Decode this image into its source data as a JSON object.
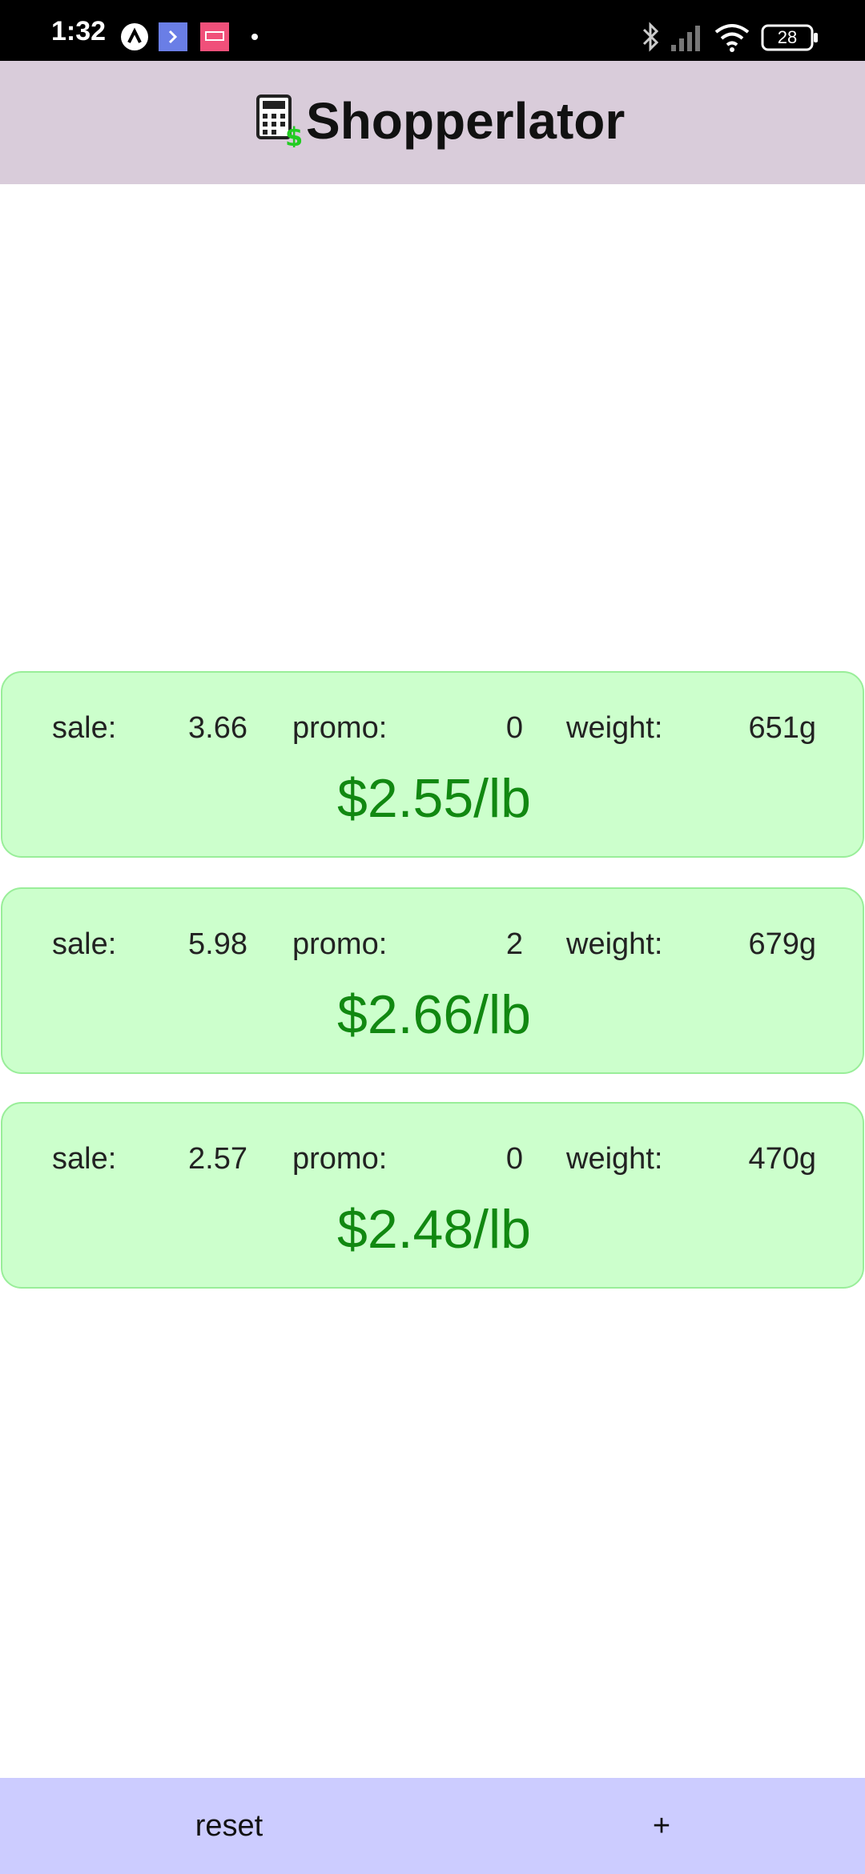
{
  "status_bar": {
    "time": "1:32",
    "battery": "28",
    "left_icons": [
      "app-a-icon",
      "app-b-icon",
      "app-c-icon",
      "dot-icon"
    ],
    "right_icons": [
      "bluetooth-icon",
      "signal-icon",
      "wifi-icon",
      "battery-icon"
    ]
  },
  "header": {
    "title": "Shopperlator",
    "logo_icon": "calculator-dollar-icon",
    "background": "#d9ccda"
  },
  "items": [
    {
      "sale_label": "sale:",
      "sale": "3.66",
      "promo_label": "promo:",
      "promo": "0",
      "weight_label": "weight:",
      "weight": "651g",
      "unit_price": "$2.55/lb"
    },
    {
      "sale_label": "sale:",
      "sale": "5.98",
      "promo_label": "promo:",
      "promo": "2",
      "weight_label": "weight:",
      "weight": "679g",
      "unit_price": "$2.66/lb"
    },
    {
      "sale_label": "sale:",
      "sale": "2.57",
      "promo_label": "promo:",
      "promo": "0",
      "weight_label": "weight:",
      "weight": "470g",
      "unit_price": "$2.48/lb"
    }
  ],
  "footer": {
    "reset_label": "reset",
    "add_label": "+"
  },
  "colors": {
    "card_background": "#ccffcc",
    "card_border": "#99ee99",
    "price_text": "#118811",
    "footer_background": "#ccccff"
  }
}
